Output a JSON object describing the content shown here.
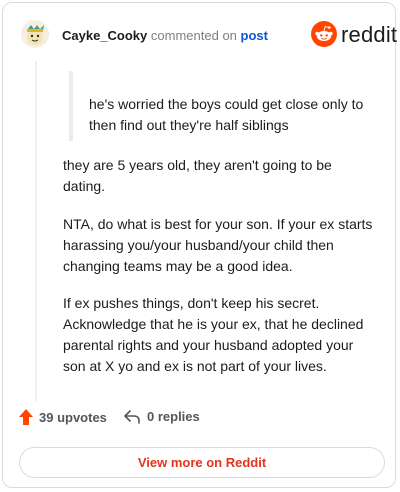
{
  "header": {
    "username": "Cayke_Cooky",
    "action_text": "commented on",
    "post_link": "post",
    "brand": "reddit"
  },
  "comment": {
    "quote": "he's worried the boys could get close only to then find out they're half siblings",
    "paragraphs": [
      "they are 5 years old, they aren't going to be dating.",
      "NTA, do what is best for your son. If your ex starts harassing you/your husband/your child then changing teams may be a good idea.",
      "If ex pushes things, don't keep his secret. Acknowledge that he is your ex, that he declined parental rights and your husband adopted your son at X yo and ex is not part of your lives."
    ]
  },
  "footer": {
    "upvotes": "39 upvotes",
    "replies": "0 replies",
    "view_more": "View more on Reddit"
  },
  "colors": {
    "brand": "#ff4500",
    "link": "#0a58d6",
    "cta": "#e2341f"
  },
  "icons": [
    "avatar",
    "reddit-snoo-icon",
    "upvote-arrow-icon",
    "reply-arrow-icon"
  ]
}
